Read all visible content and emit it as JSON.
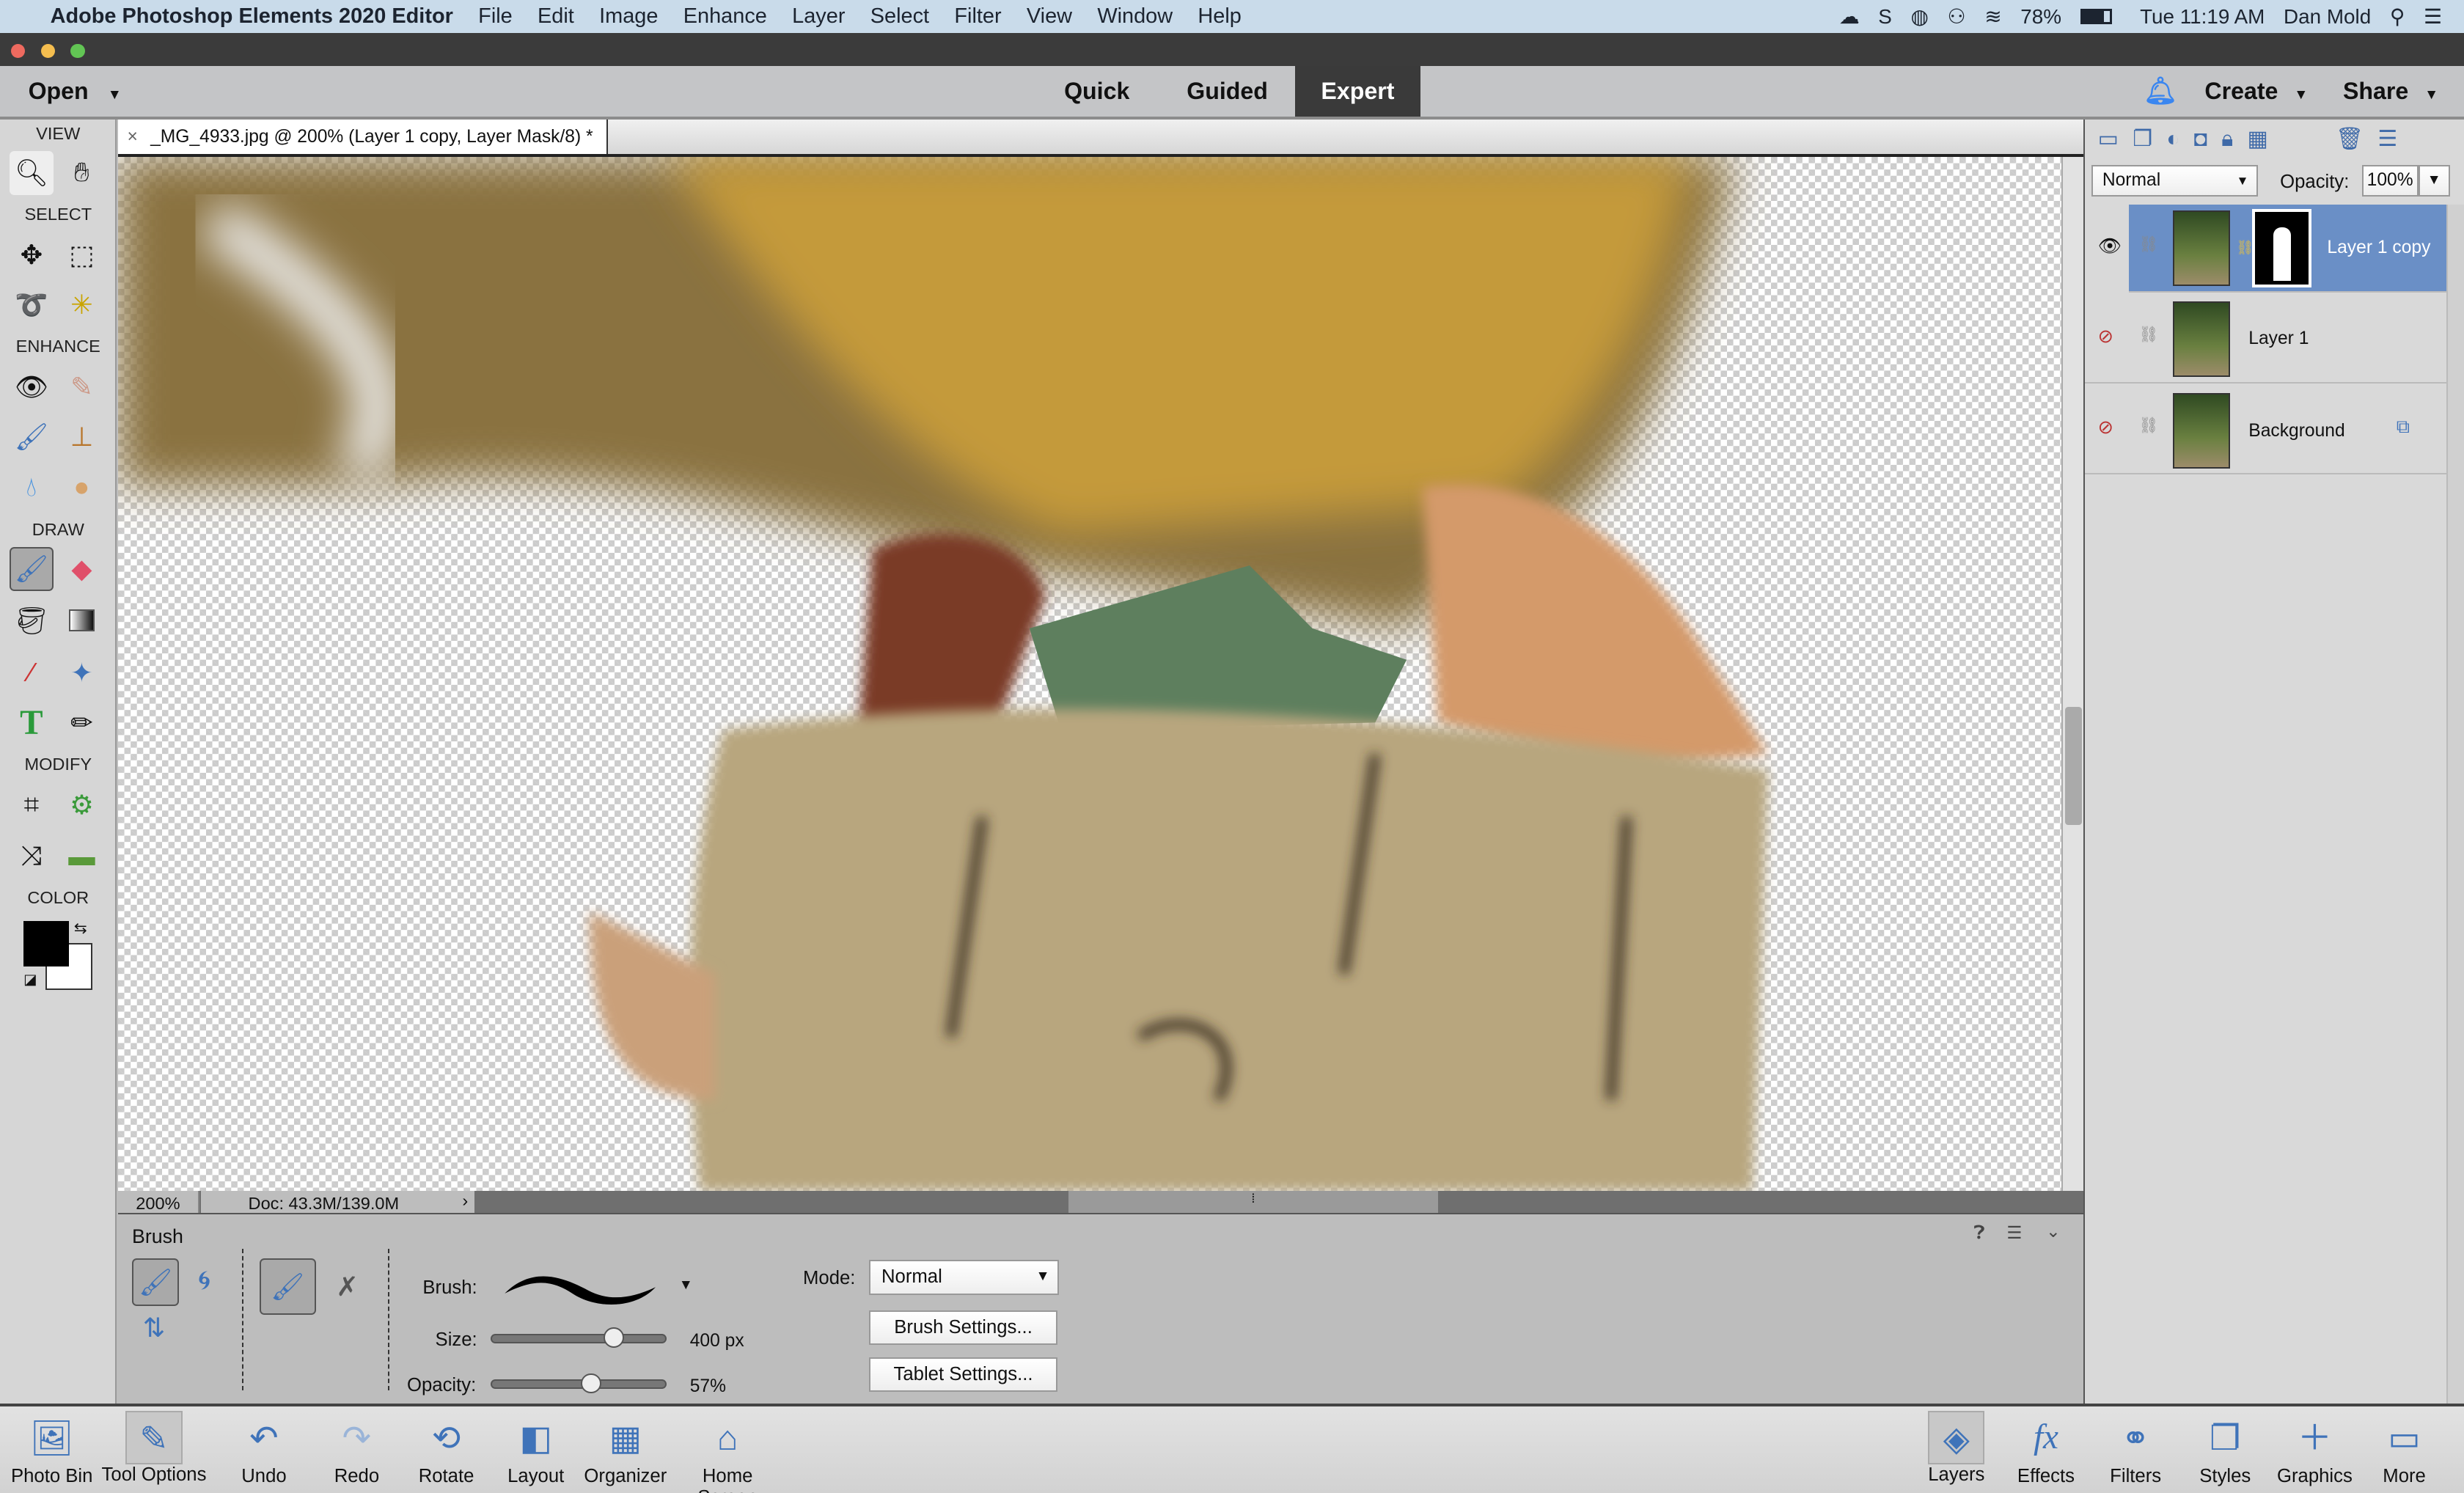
{
  "menubar": {
    "app": "Adobe Photoshop Elements 2020 Editor",
    "items": [
      "File",
      "Edit",
      "Image",
      "Enhance",
      "Layer",
      "Select",
      "Filter",
      "View",
      "Window",
      "Help"
    ],
    "battery": "78%",
    "clock": "Tue 11:19 AM",
    "user": "Dan Mold"
  },
  "header": {
    "open": "Open",
    "tabs": [
      "Quick",
      "Guided",
      "Expert"
    ],
    "active_tab": "Expert",
    "create": "Create",
    "share": "Share"
  },
  "toolbox": {
    "sections": [
      "VIEW",
      "SELECT",
      "ENHANCE",
      "DRAW",
      "MODIFY",
      "COLOR"
    ],
    "foreground": "#000000",
    "background": "#ffffff"
  },
  "document": {
    "tab_close": "×",
    "tab_title": "_MG_4933.jpg @ 200% (Layer 1 copy, Layer Mask/8) *"
  },
  "status": {
    "zoom": "200%",
    "doc": "Doc: 43.3M/139.0M",
    "arrow": "›"
  },
  "tool_options": {
    "tool": "Brush",
    "brush_label": "Brush:",
    "size_label": "Size:",
    "size_value": "400 px",
    "size_percent": 0.7,
    "opacity_label": "Opacity:",
    "opacity_value": "57%",
    "opacity_percent": 0.57,
    "mode_label": "Mode:",
    "mode_value": "Normal",
    "brush_settings": "Brush Settings...",
    "tablet_settings": "Tablet Settings..."
  },
  "layers_panel": {
    "blend_mode": "Normal",
    "opacity_label": "Opacity:",
    "opacity_value": "100%",
    "layers": [
      {
        "name": "Layer 1 copy",
        "visible": true,
        "selected": true
      },
      {
        "name": "Layer 1",
        "visible": false
      },
      {
        "name": "Background",
        "visible": false
      }
    ]
  },
  "bottombar": {
    "left": [
      "Photo Bin",
      "Tool Options",
      "Undo",
      "Redo",
      "Rotate",
      "Layout",
      "Organizer",
      "Home Screen"
    ],
    "right": [
      "Layers",
      "Effects",
      "Filters",
      "Styles",
      "Graphics",
      "More"
    ]
  },
  "colors": {
    "accent": "#6a8fc6",
    "expert_tab": "#3a3a3a",
    "menubar": "#c9dbea"
  }
}
